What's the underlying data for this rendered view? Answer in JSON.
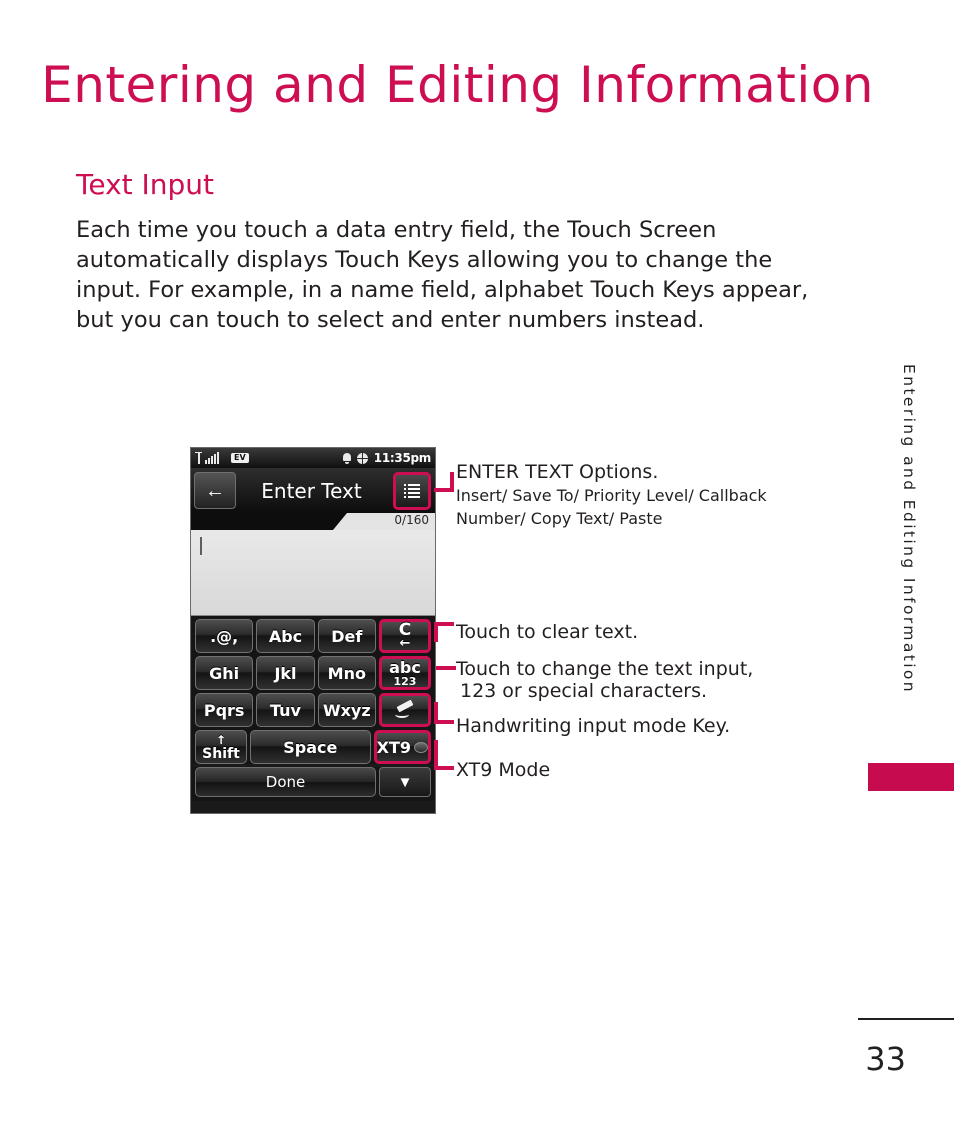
{
  "page": {
    "title": "Entering and Editing Information",
    "section_heading": "Text Input",
    "body": "Each time you touch a data entry field, the Touch Screen automatically displays Touch Keys allowing you to change the input. For example, in a name field, alphabet Touch Keys appear, but you can touch to select and enter numbers instead.",
    "running_head": "Entering and Editing Information",
    "page_number": "33",
    "accent_color": "#CE0E53",
    "tab_color": "#C60C4E"
  },
  "phone": {
    "status_bar": {
      "signal_icon": "signal-bars-icon",
      "network_badge": "EV",
      "alert_icon": "bell-icon",
      "globe_icon": "globe-icon",
      "time": "11:35pm"
    },
    "title_bar": {
      "back_icon": "←",
      "title": "Enter Text",
      "menu_icon": "list-menu-icon"
    },
    "counter": "0/160",
    "text_field": {
      "value": "",
      "caret": true
    },
    "keypad": {
      "rows": [
        [
          {
            "label": ".@,",
            "name": "key-punctuation",
            "highlight": false
          },
          {
            "label": "Abc",
            "name": "key-abc",
            "highlight": false
          },
          {
            "label": "Def",
            "name": "key-def",
            "highlight": false
          }
        ],
        [
          {
            "label": "Ghi",
            "name": "key-ghi",
            "highlight": false
          },
          {
            "label": "Jkl",
            "name": "key-jkl",
            "highlight": false
          },
          {
            "label": "Mno",
            "name": "key-mno",
            "highlight": false
          }
        ],
        [
          {
            "label": "Pqrs",
            "name": "key-pqrs",
            "highlight": false
          },
          {
            "label": "Tuv",
            "name": "key-tuv",
            "highlight": false
          },
          {
            "label": "Wxyz",
            "name": "key-wxyz",
            "highlight": false
          }
        ]
      ],
      "shift_label": "Shift",
      "shift_arrow": "↑",
      "space_label": "Space",
      "side_keys": {
        "clear_c": "C",
        "clear_arrow": "←",
        "mode_main": "abc",
        "mode_sub": "123",
        "handwriting_icon": "pencil-icon",
        "xt9_label": "XT9"
      }
    },
    "bottom": {
      "done_label": "Done",
      "down_icon": "▼"
    }
  },
  "annotations": {
    "options": {
      "title": "ENTER TEXT Options.",
      "line1": "Insert/ Save To/ Priority Level/ Callback",
      "line2": "Number/ Copy Text/ Paste"
    },
    "clear": "Touch to clear text.",
    "mode_line1": "Touch to change the text input,",
    "mode_line2": "123 or special characters.",
    "handwriting": "Handwriting input mode Key.",
    "xt9": "XT9 Mode"
  }
}
